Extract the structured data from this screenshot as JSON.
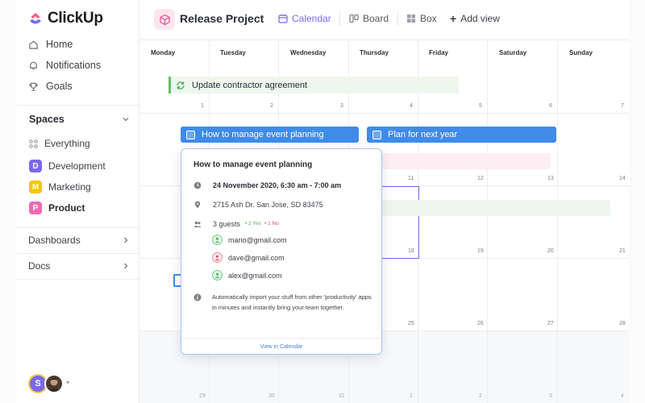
{
  "app": {
    "name": "ClickUp"
  },
  "sidebar": {
    "nav": [
      {
        "label": "Home",
        "icon": "home-icon"
      },
      {
        "label": "Notifications",
        "icon": "bell-icon"
      },
      {
        "label": "Goals",
        "icon": "trophy-icon"
      }
    ],
    "spaces_label": "Spaces",
    "spaces": [
      {
        "label": "Everything",
        "icon": "grid-icon"
      },
      {
        "label": "Development",
        "initial": "D",
        "color": "#7b68ee"
      },
      {
        "label": "Marketing",
        "initial": "M",
        "color": "#f7c600"
      },
      {
        "label": "Product",
        "initial": "P",
        "color": "#f06ab4"
      }
    ],
    "dashboards_label": "Dashboards",
    "docs_label": "Docs",
    "user_initial": "S"
  },
  "header": {
    "project_title": "Release Project",
    "views": [
      {
        "label": "Calendar",
        "icon": "calendar-icon",
        "active": true
      },
      {
        "label": "Board",
        "icon": "board-icon"
      },
      {
        "label": "Box",
        "icon": "box-icon"
      }
    ],
    "add_view_label": "Add view"
  },
  "calendar": {
    "days": [
      "Monday",
      "Tuesday",
      "Wednesday",
      "Thursday",
      "Friday",
      "Saturday",
      "Sunday"
    ],
    "weeks": [
      [
        "1",
        "2",
        "3",
        "4",
        "5",
        "6",
        "7"
      ],
      [
        "",
        "",
        "",
        "11",
        "12",
        "13",
        "14"
      ],
      [
        "",
        "",
        "",
        "18",
        "19",
        "20",
        "21"
      ],
      [
        "",
        "",
        "",
        "25",
        "26",
        "27",
        "28"
      ],
      [
        "29",
        "30",
        "31",
        "1",
        "2",
        "3",
        "4"
      ]
    ],
    "events": {
      "contractor": "Update contractor agreement",
      "event_planning": "How to manage event planning",
      "plan_next_year": "Plan for next year"
    }
  },
  "popup": {
    "title": "How to manage event planning",
    "datetime": "24 November 2020, 6:30 am - 7:00 am",
    "address": "2715 Ash Dr. San Jose, SD 83475",
    "guests_label": "3 guests",
    "yes_label": "2 Yes",
    "no_label": "1 No",
    "guests": [
      {
        "email": "mario@gmail.com",
        "status": "yes"
      },
      {
        "email": "dave@gmail.com",
        "status": "no"
      },
      {
        "email": "alex@gmail.com",
        "status": "yes"
      }
    ],
    "description": "Automatically import your stuff from other 'productivity' apps in minutes and instantly bring your team together.",
    "footer_link": "View in Calendar"
  }
}
